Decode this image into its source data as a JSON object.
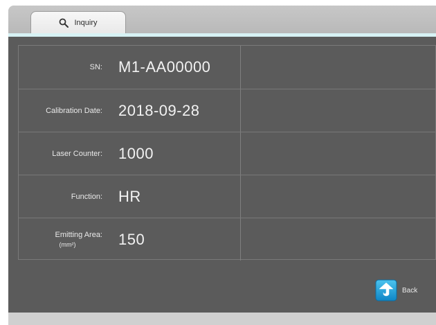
{
  "tabs": [
    {
      "label": "Inquiry",
      "icon": "search-icon",
      "active": true
    }
  ],
  "info": {
    "rows": [
      {
        "label": "SN:",
        "value": "M1-AA00000"
      },
      {
        "label": "Calibration Date:",
        "value": "2018-09-28"
      },
      {
        "label": "Laser Counter:",
        "value": "1000"
      },
      {
        "label": "Function:",
        "value": "HR"
      },
      {
        "label": "Emitting Area:",
        "unit": "(mm²)",
        "value": "150"
      }
    ]
  },
  "actions": {
    "back_label": "Back",
    "back_icon": "back-arrow-icon"
  },
  "colors": {
    "panel": "#5b5b5b",
    "accent": "#d7f2f4",
    "back_icon_blue": "#1aa3dd"
  }
}
